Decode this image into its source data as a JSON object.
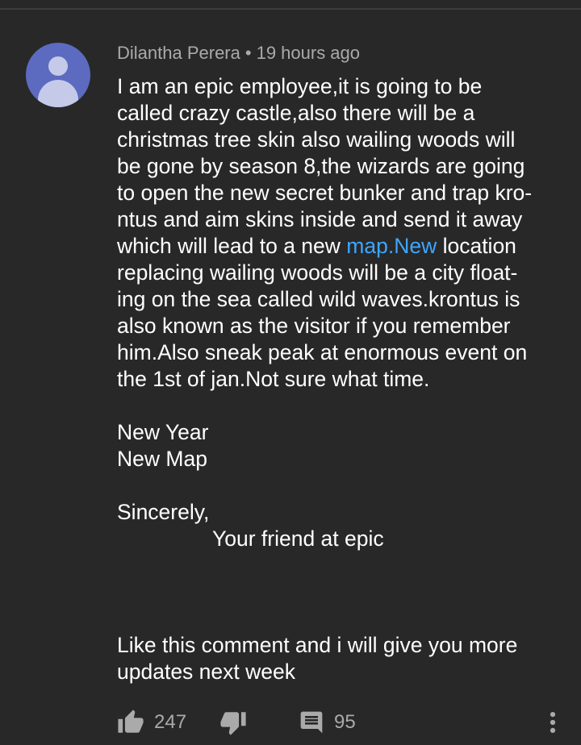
{
  "comment": {
    "author": "Dilantha Perera",
    "separator": "•",
    "timestamp": "19 hours ago",
    "lines": [
      {
        "text": "I am an epic employee,it is going to be"
      },
      {
        "text": "called crazy castle,also there will be a"
      },
      {
        "text": "christmas tree skin also wailing woods will"
      },
      {
        "text": "be gone by season 8,the wizards are going"
      },
      {
        "text": "to open the new secret bunker and trap kro-"
      },
      {
        "text": "ntus and aim skins inside and send it away"
      },
      {
        "before": "which will lead to a new ",
        "link": "map.New",
        "after": " location"
      },
      {
        "text": "replacing wailing woods will be a city float-"
      },
      {
        "text": "ing on the sea called wild waves.krontus is"
      },
      {
        "text": "also known as the visitor if you remember"
      },
      {
        "text": "him.Also sneak peak at enormous event on"
      },
      {
        "text": "the 1st of jan.Not sure what time."
      },
      {
        "text": ""
      },
      {
        "text": "New Year"
      },
      {
        "text": "New Map"
      },
      {
        "text": ""
      },
      {
        "text": "Sincerely,"
      },
      {
        "text": "Your friend at epic"
      },
      {
        "text": ""
      },
      {
        "text": ""
      },
      {
        "text": ""
      },
      {
        "text": "Like this comment and i will give you more"
      },
      {
        "text": "updates next week"
      }
    ]
  },
  "actions": {
    "like_count": "247",
    "reply_count": "95"
  },
  "icons": {
    "like": "thumbs-up-icon",
    "dislike": "thumbs-down-icon",
    "reply": "comment-icon",
    "more": "more-vertical-icon"
  }
}
